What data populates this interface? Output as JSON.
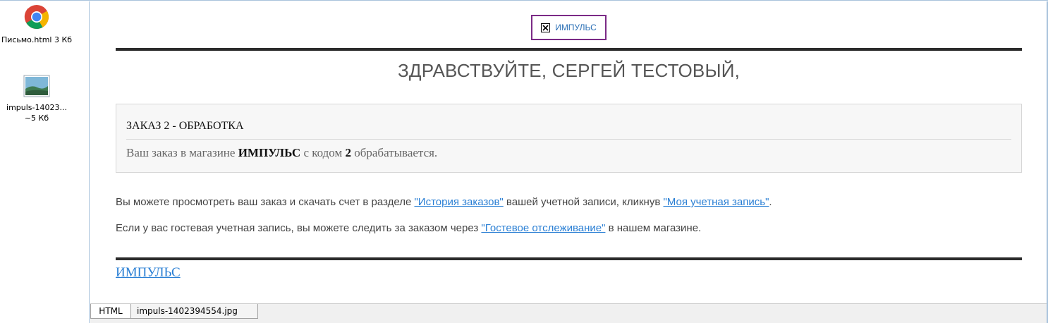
{
  "attachments": [
    {
      "name": "Письмо.html 3 Кб",
      "icon": "chrome-icon"
    },
    {
      "name": "impuls-14023... ~5 Кб",
      "icon": "image-file-icon"
    }
  ],
  "email": {
    "logo_alt": "ИМПУЛЬС",
    "greeting": "ЗДРАВСТВУЙТЕ, СЕРГЕЙ ТЕСТОВЫЙ,",
    "order": {
      "title": "ЗАКАЗ 2 - ОБРАБОТКА",
      "text_prefix": "Ваш заказ в магазине ",
      "store": "ИМПУЛЬС",
      "text_middle": " с кодом ",
      "order_code": "2",
      "text_suffix": " обрабатывается."
    },
    "line1": {
      "prefix": "Вы можете просмотреть ваш заказ и скачать счет в разделе ",
      "link1": "\"История заказов\"",
      "middle": " вашей учетной записи, кликнув ",
      "link2": "\"Моя учетная запись\"",
      "suffix": "."
    },
    "line2": {
      "prefix": "Если у вас гостевая учетная запись, вы можете следить за заказом через ",
      "link": "\"Гостевое отслеживание\"",
      "suffix": " в нашем магазине."
    },
    "footer_link": "ИМПУЛЬС"
  },
  "tabs": [
    {
      "label": "HTML",
      "active": true
    },
    {
      "label": "impuls-1402394554.jpg",
      "active": false
    }
  ],
  "colors": {
    "link": "#2a7fd4",
    "logo_border": "#7b2a86",
    "pane_border": "#a9c3dc"
  }
}
